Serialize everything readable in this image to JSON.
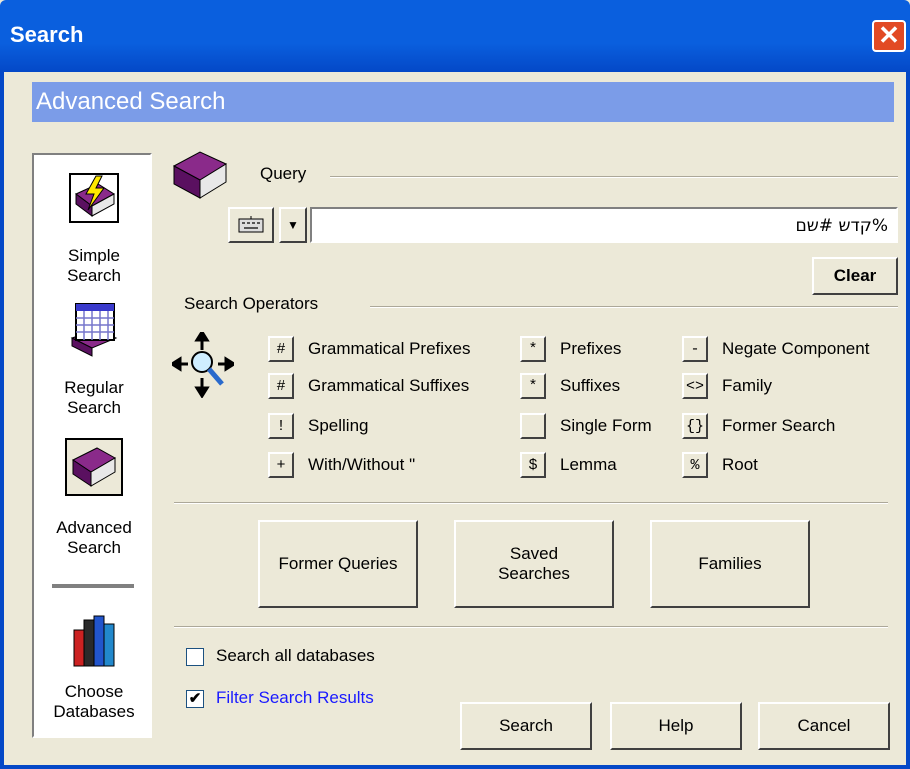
{
  "window": {
    "title": "Search",
    "close_glyph": "✕"
  },
  "header": {
    "title": "Advanced Search"
  },
  "sidebar": {
    "items": [
      {
        "label1": "Simple",
        "label2": "Search"
      },
      {
        "label1": "Regular",
        "label2": "Search"
      },
      {
        "label1": "Advanced",
        "label2": "Search"
      },
      {
        "label1": "Choose",
        "label2": "Databases"
      }
    ]
  },
  "query": {
    "label": "Query",
    "value": "%קדש #שם",
    "clear_label": "Clear"
  },
  "operators": {
    "label": "Search Operators",
    "items": [
      {
        "sym": "#",
        "label": "Grammatical Prefixes"
      },
      {
        "sym": "*",
        "label": "Prefixes"
      },
      {
        "sym": "-",
        "label": "Negate Component"
      },
      {
        "sym": "#",
        "label": "Grammatical Suffixes"
      },
      {
        "sym": "*",
        "label": "Suffixes"
      },
      {
        "sym": "<>",
        "label": "Family"
      },
      {
        "sym": "!",
        "label": "Spelling"
      },
      {
        "sym": "",
        "label": "Single Form"
      },
      {
        "sym": "{}",
        "label": "Former Search"
      },
      {
        "sym": "+",
        "label": "With/Without \""
      },
      {
        "sym": "$",
        "label": "Lemma"
      },
      {
        "sym": "%",
        "label": "Root"
      }
    ]
  },
  "actions": {
    "former_queries": "Former Queries",
    "saved_line1": "Saved",
    "saved_line2": "Searches",
    "families": "Families"
  },
  "options": {
    "search_all": {
      "label": "Search all databases",
      "checked": false
    },
    "filter": {
      "label": "Filter Search Results",
      "checked": true
    }
  },
  "footer": {
    "search": "Search",
    "help": "Help",
    "cancel": "Cancel"
  }
}
